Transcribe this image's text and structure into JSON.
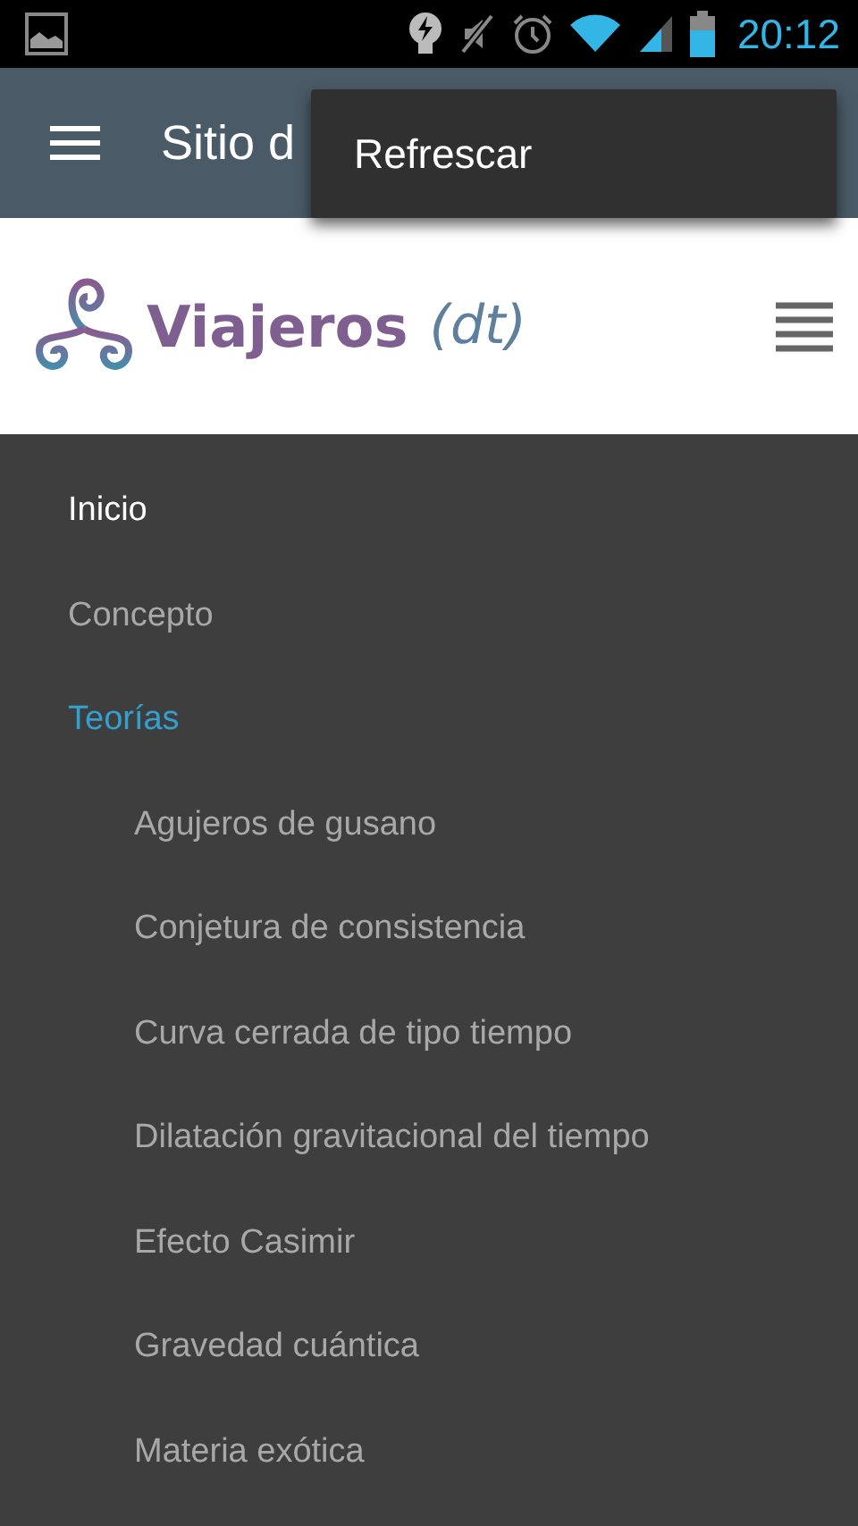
{
  "status_bar": {
    "time": "20:12"
  },
  "app_bar": {
    "title": "Sitio d"
  },
  "overflow_menu": {
    "items": [
      "Refrescar"
    ]
  },
  "site_header": {
    "logo_name": "Viajeros",
    "logo_suffix": "(dt)"
  },
  "nav": {
    "items": [
      {
        "label": "Inicio",
        "selected": true,
        "expanded": false
      },
      {
        "label": "Concepto",
        "selected": false,
        "expanded": false
      },
      {
        "label": "Teorías",
        "selected": false,
        "expanded": true,
        "children": [
          {
            "label": "Agujeros de gusano",
            "selected": false
          },
          {
            "label": "Conjetura de consistencia",
            "selected": false
          },
          {
            "label": "Curva cerrada de tipo tiempo",
            "selected": false
          },
          {
            "label": "Dilatación gravitacional del tiempo",
            "selected": false
          },
          {
            "label": "Efecto Casimir",
            "selected": false
          },
          {
            "label": "Gravedad cuántica",
            "selected": false
          },
          {
            "label": "Materia exótica",
            "selected": false
          }
        ]
      }
    ]
  }
}
